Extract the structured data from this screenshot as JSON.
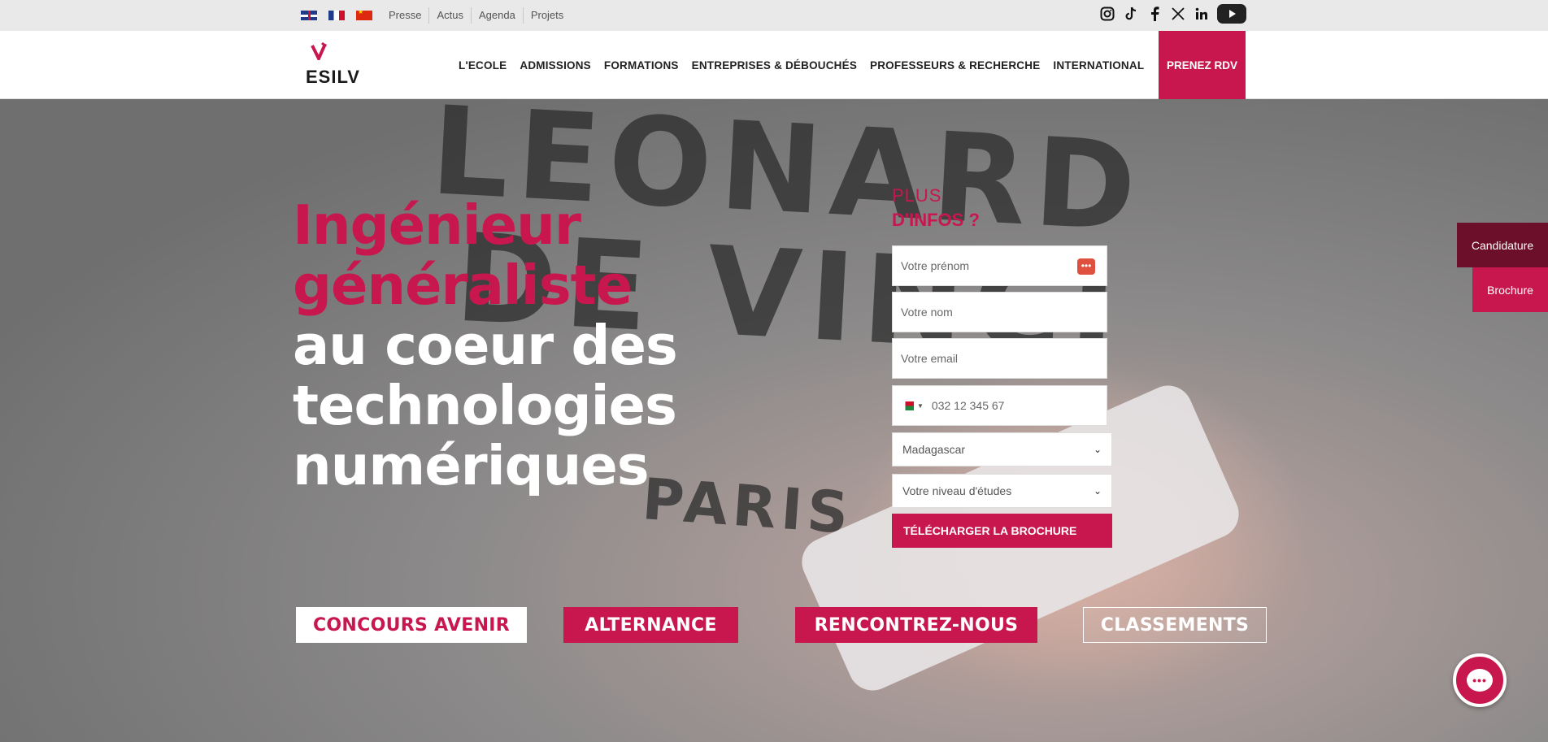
{
  "topbar": {
    "flags": [
      "flag-uk",
      "flag-fr",
      "flag-cn"
    ],
    "links": [
      "Presse",
      "Actus",
      "Agenda",
      "Projets"
    ],
    "socials": [
      "instagram-icon",
      "tiktok-icon",
      "facebook-icon",
      "x-icon",
      "linkedin-icon",
      "youtube-icon"
    ]
  },
  "nav": {
    "logo": "ESILV",
    "items": [
      "L'ECOLE",
      "ADMISSIONS",
      "FORMATIONS",
      "ENTREPRISES & DÉBOUCHÉS",
      "PROFESSEURS & RECHERCHE",
      "INTERNATIONAL"
    ],
    "cta": "PRENEZ RDV"
  },
  "hero": {
    "title_line1": "Ingénieur",
    "title_line2": "généraliste",
    "title_line3": "au coeur des",
    "title_line4": "technologies",
    "title_line5": "numériques",
    "shirt_text_1": "LEONARD",
    "shirt_text_2": "DE VINCI",
    "shirt_text_3": "PARIS"
  },
  "form": {
    "heading_1": "PLUS",
    "heading_2": "D'INFOS ?",
    "firstname_placeholder": "Votre prénom",
    "lastname_placeholder": "Votre nom",
    "email_placeholder": "Votre email",
    "phone_placeholder": "032 12 345 67",
    "country_value": "Madagascar",
    "level_value": "Votre niveau d'études",
    "submit_label": "TÉLÉCHARGER LA BROCHURE"
  },
  "ctas": {
    "concours": "CONCOURS AVENIR",
    "alternance": "ALTERNANCE",
    "rencontrez": "RENCONTREZ-NOUS",
    "classements": "CLASSEMENTS"
  },
  "side": {
    "candidature": "Candidature",
    "brochure": "Brochure"
  },
  "colors": {
    "accent": "#c8174f",
    "dark_accent": "#6b0f2a"
  }
}
